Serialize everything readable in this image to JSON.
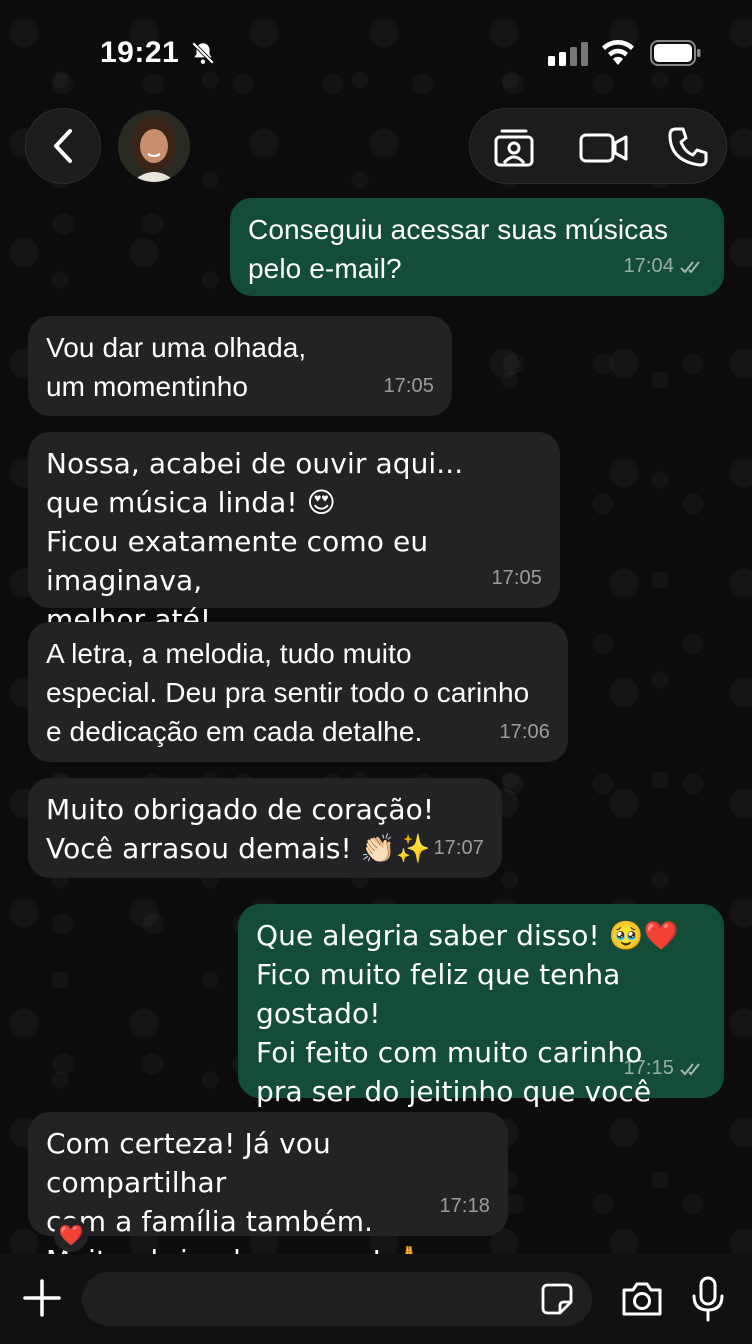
{
  "status_bar": {
    "time": "19:21"
  },
  "header": {
    "back_label": "Back",
    "icons": [
      "back-chevron-icon",
      "contact-card-icon",
      "video-call-icon",
      "phone-call-icon"
    ]
  },
  "messages": [
    {
      "direction": "out",
      "text": "Conseguiu acessar suas músicas\npelo e-mail?",
      "time": "17:04",
      "read": true
    },
    {
      "direction": "in",
      "text": "Vou dar uma olhada,\num momentinho",
      "time": "17:05"
    },
    {
      "direction": "in",
      "text": "Nossa, acabei de ouvir aqui...\nque música linda! 😍\nFicou exatamente como eu imaginava,\nmelhor até!",
      "time": "17:05"
    },
    {
      "direction": "in",
      "text": "A letra, a melodia, tudo muito\nespecial. Deu pra sentir todo o carinho\ne dedicação em cada detalhe.",
      "time": "17:06"
    },
    {
      "direction": "in",
      "text": "Muito obrigado de coração!\nVocê arrasou demais! 👏🏻✨",
      "time": "17:07"
    },
    {
      "direction": "out",
      "text": "Que alegria saber disso! 🥹❤️\nFico muito feliz que tenha gostado!\nFoi feito com muito carinho\npra ser do jeitinho que você sonhou.",
      "time": "17:15",
      "read": true
    },
    {
      "direction": "in",
      "text": "Com certeza! Já vou compartilhar\ncom a família também.\nMuito obrigado mesmo! 🙏",
      "time": "17:18"
    }
  ],
  "last_reaction": "❤️",
  "composer": {
    "placeholder": ""
  },
  "colors": {
    "outgoing_bubble": "#144d37",
    "incoming_bubble": "#232325",
    "background": "#0c0c0c"
  }
}
